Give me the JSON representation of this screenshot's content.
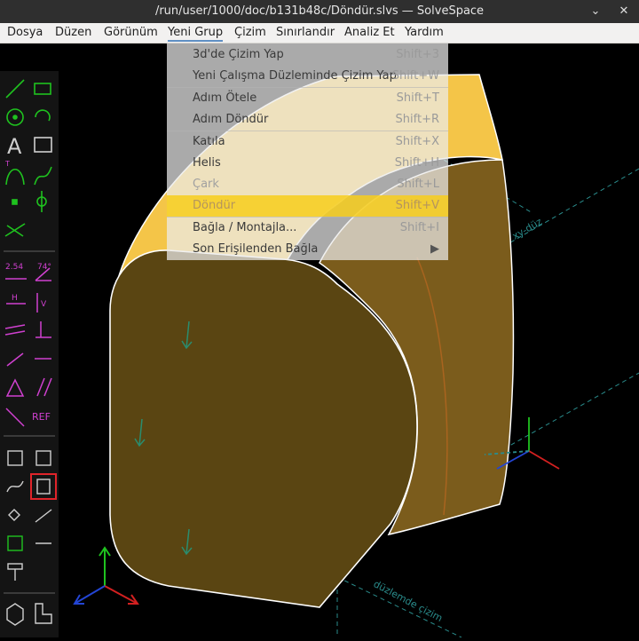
{
  "window": {
    "title": "/run/user/1000/doc/b131b48c/Döndür.slvs — SolveSpace",
    "minimize_icon": "chevron-down-icon",
    "close_icon": "close-icon"
  },
  "menubar": {
    "items": [
      "Dosya",
      "Düzen",
      "Görünüm",
      "Yeni Grup",
      "Çizim",
      "Sınırlandır",
      "Analiz Et",
      "Yardım"
    ],
    "active": "Yeni Grup"
  },
  "dropdown": {
    "items": [
      {
        "label": "3d'de Çizim Yap",
        "shortcut": "Shift+3",
        "enabled": true
      },
      {
        "label": "Yeni Çalışma Düzleminde Çizim Yap",
        "shortcut": "Shift+W",
        "enabled": true
      },
      {
        "label": "Adım Ötele",
        "shortcut": "Shift+T",
        "enabled": true
      },
      {
        "label": "Adım Döndür",
        "shortcut": "Shift+R",
        "enabled": true
      },
      {
        "label": "Katıla",
        "shortcut": "Shift+X",
        "enabled": true
      },
      {
        "label": "Helis",
        "shortcut": "Shift+H",
        "enabled": true
      },
      {
        "label": "Çark",
        "shortcut": "Shift+L",
        "enabled": false
      },
      {
        "label": "Döndür",
        "shortcut": "Shift+V",
        "enabled": true,
        "highlighted": true
      },
      {
        "label": "Bağla / Montajla...",
        "shortcut": "Shift+I",
        "enabled": true
      },
      {
        "label": "Son Erişilenden Bağla",
        "shortcut": "",
        "enabled": true,
        "submenu": true
      }
    ],
    "submenu_icon": "triangle-right-icon"
  },
  "toolbar": {
    "dim_label": "2.54",
    "angle_label": "74°",
    "horiz_label": "H",
    "vert_label": "V",
    "ref_label": "REF",
    "tangent_label": "T",
    "selected_tool": "revolve",
    "tools": [
      "line-icon",
      "rectangle-icon",
      "circle-icon",
      "arc-icon",
      "text-icon",
      "image-icon",
      "tangent-arc-icon",
      "spline-icon",
      "point-icon",
      "workplane-icon",
      "construction-icon",
      "distance-icon",
      "angle-icon",
      "horizontal-icon",
      "vertical-icon",
      "parallel-icon",
      "perpendicular-icon",
      "point-on-line-icon",
      "symmetric-icon",
      "equal-icon",
      "same-orientation-icon",
      "other-supplementary-icon",
      "reference-icon",
      "extrude-icon",
      "lathe-icon",
      "helix-icon",
      "revolve-icon",
      "step-translate-icon",
      "step-rotate-icon",
      "section-icon",
      "workplane-view-icon",
      "mirror-icon",
      "assemble-icon",
      "solid-icon",
      "l-shape-icon"
    ]
  },
  "viewport": {
    "label_xy": "xy-düz",
    "label_plane": "düzlemde çizim",
    "colors": {
      "face": "#5a4512",
      "face_light": "#f5c242",
      "edge": "#ffffff",
      "axis_x": "#d32020",
      "axis_y": "#1fc21f",
      "axis_z": "#2345d4",
      "grid": "#2a8c8c"
    }
  }
}
